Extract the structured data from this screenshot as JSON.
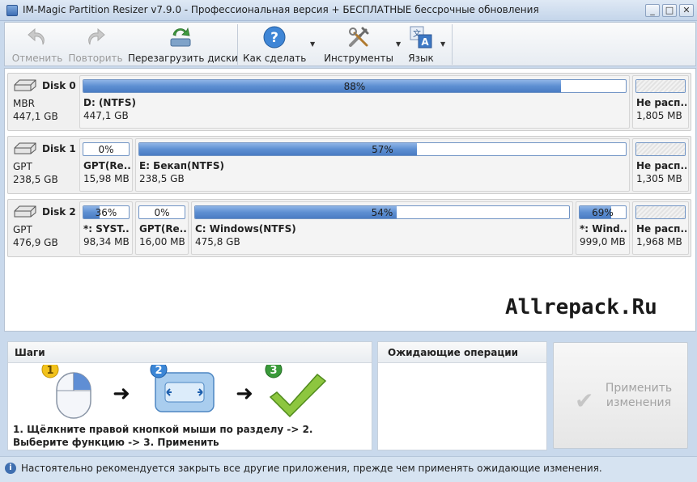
{
  "window": {
    "title": "IM-Magic Partition Resizer v7.9.0 - Профессиональная версия + БЕСПЛАТНЫЕ бессрочные обновления",
    "minimize": "_",
    "maximize": "□",
    "close": "✕"
  },
  "toolbar": {
    "undo": "Отменить",
    "redo": "Повторить",
    "reload": "Перезагрузить диски",
    "howto": "Как сделать",
    "tools": "Инструменты",
    "language": "Язык",
    "dropdown_glyph": "▼"
  },
  "disks": [
    {
      "name": "Disk 0",
      "type": "MBR",
      "size": "447,1 GB",
      "partitions": [
        {
          "label": "D: (NTFS)",
          "size": "447,1 GB",
          "percent": "88%",
          "used": 0.88
        },
        {
          "label": "Не расп...",
          "size": "1,805 MB",
          "percent": "",
          "used": 0,
          "unallocated": true
        }
      ]
    },
    {
      "name": "Disk 1",
      "type": "GPT",
      "size": "238,5 GB",
      "partitions": [
        {
          "label": "GPT(Re...",
          "size": "15,98 MB",
          "percent": "0%",
          "used": 0
        },
        {
          "label": "E: Бекап(NTFS)",
          "size": "238,5 GB",
          "percent": "57%",
          "used": 0.57
        },
        {
          "label": "Не расп...",
          "size": "1,305 MB",
          "percent": "",
          "used": 0,
          "unallocated": true
        }
      ]
    },
    {
      "name": "Disk 2",
      "type": "GPT",
      "size": "476,9 GB",
      "partitions": [
        {
          "label": "*: SYST...",
          "size": "98,34 MB",
          "percent": "36%",
          "used": 0.36
        },
        {
          "label": "GPT(Re...",
          "size": "16,00 MB",
          "percent": "0%",
          "used": 0
        },
        {
          "label": "C: Windows(NTFS)",
          "size": "475,8 GB",
          "percent": "54%",
          "used": 0.54
        },
        {
          "label": "*: Wind...",
          "size": "999,0 MB",
          "percent": "69%",
          "used": 0.69
        },
        {
          "label": "Не расп...",
          "size": "1,968 MB",
          "percent": "",
          "used": 0,
          "unallocated": true
        }
      ]
    }
  ],
  "watermark": "Allrepack.Ru",
  "steps": {
    "title": "Шаги",
    "badges": [
      "1",
      "2",
      "3"
    ],
    "arrow": "➜",
    "text": "1. Щёлкните правой кнопкой мыши по разделу -> 2. Выберите функцию -> 3. Применить"
  },
  "pending": {
    "title": "Ожидающие операции"
  },
  "apply": {
    "label": "Применить изменения",
    "check": "✔"
  },
  "status": {
    "icon": "i",
    "text": "Настоятельно рекомендуется закрыть все другие приложения, прежде чем применять ожидающие изменения."
  },
  "colors": {
    "bar_fill": "#5d8fd2",
    "bar_border": "#6f93c4",
    "window_frame": "#c9d9ec"
  }
}
